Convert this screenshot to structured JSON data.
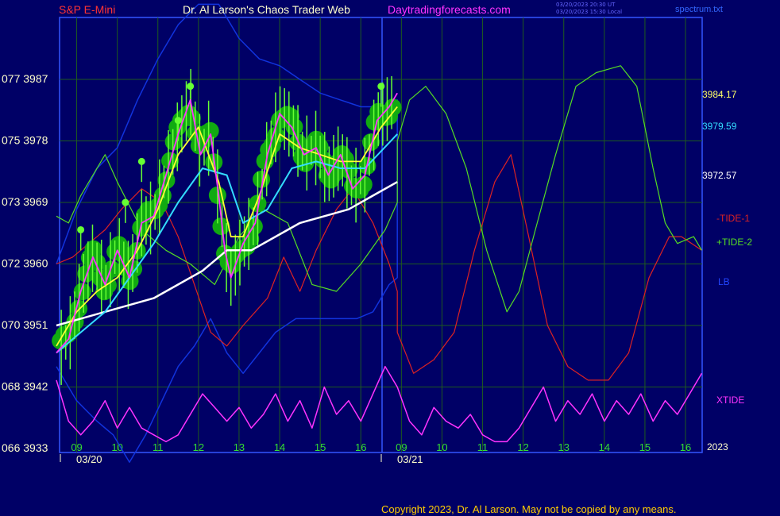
{
  "header": {
    "symbol": "S&P E-Mini",
    "title": "Dr. Al Larson's Chaos Trader Web",
    "site": "Daytradingforecasts.com",
    "ts_utc": "03/20/2023 20:30 UT",
    "ts_local": "03/20/2023 15:30 Local",
    "file": "spectrum.txt"
  },
  "right_labels": {
    "price_a": "3984.17",
    "price_b": "3979.59",
    "price_c": "3972.57",
    "tide1": "-TIDE-1",
    "tide2": "+TIDE-2",
    "lb": "LB",
    "xtide": "XTIDE",
    "year": "2023"
  },
  "copyright": "Copyright 2023, Dr. Al Larson. May not be copied by any means.",
  "colors": {
    "background": "#000066",
    "grid": "#1e5a1e",
    "axis": "#3355ff",
    "price": "#ff33ff",
    "ma_yellow": "#ffff33",
    "ma_cyan": "#33ddff",
    "ma_white": "#ffffff",
    "tide1": "#dd2222",
    "tide2": "#55dd22",
    "lb": "#1133dd",
    "xtide": "#ff33ff",
    "dots": "#11aa11",
    "bars": "#66ff33"
  },
  "chart_data": {
    "type": "line",
    "y_ticks": [
      {
        "label": "066 3933",
        "value": 3933
      },
      {
        "label": "068 3942",
        "value": 3942
      },
      {
        "label": "070 3951",
        "value": 3951
      },
      {
        "label": "072 3960",
        "value": 3960
      },
      {
        "label": "073 3969",
        "value": 3969
      },
      {
        "label": "075 3978",
        "value": 3978
      },
      {
        "label": "077 3987",
        "value": 3987
      }
    ],
    "ylim": [
      3933,
      3992
    ],
    "x_ticks": [
      {
        "label": "09",
        "t": 0.5
      },
      {
        "label": "10",
        "t": 1.5
      },
      {
        "label": "11",
        "t": 2.5
      },
      {
        "label": "12",
        "t": 3.5
      },
      {
        "label": "13",
        "t": 4.5
      },
      {
        "label": "14",
        "t": 5.5
      },
      {
        "label": "15",
        "t": 6.5
      },
      {
        "label": "16",
        "t": 7.5
      },
      {
        "label": "09",
        "t": 8.5
      },
      {
        "label": "10",
        "t": 9.5
      },
      {
        "label": "11",
        "t": 10.5
      },
      {
        "label": "12",
        "t": 11.5
      },
      {
        "label": "13",
        "t": 12.5
      },
      {
        "label": "14",
        "t": 13.5
      },
      {
        "label": "15",
        "t": 14.5
      },
      {
        "label": "16",
        "t": 15.5
      }
    ],
    "dates": [
      {
        "label": "03/20",
        "t": 0.5
      },
      {
        "label": "03/21",
        "t": 8.5
      }
    ],
    "xlim": [
      0,
      15.9
    ],
    "series": [
      {
        "key": "price",
        "points": [
          [
            0,
            3947
          ],
          [
            0.3,
            3949
          ],
          [
            0.6,
            3956
          ],
          [
            0.9,
            3961
          ],
          [
            1.2,
            3957
          ],
          [
            1.5,
            3962
          ],
          [
            1.8,
            3958
          ],
          [
            2.1,
            3966
          ],
          [
            2.4,
            3967
          ],
          [
            2.7,
            3973
          ],
          [
            3.0,
            3979
          ],
          [
            3.3,
            3984
          ],
          [
            3.55,
            3976
          ],
          [
            3.8,
            3979
          ],
          [
            4.0,
            3970
          ],
          [
            4.15,
            3962
          ],
          [
            4.3,
            3958
          ],
          [
            4.6,
            3963
          ],
          [
            4.9,
            3966
          ],
          [
            5.2,
            3976
          ],
          [
            5.5,
            3982
          ],
          [
            5.8,
            3980
          ],
          [
            6.1,
            3976
          ],
          [
            6.4,
            3977
          ],
          [
            6.7,
            3973
          ],
          [
            7.0,
            3976
          ],
          [
            7.3,
            3971
          ],
          [
            7.6,
            3973
          ],
          [
            7.9,
            3981
          ],
          [
            8.2,
            3983
          ],
          [
            8.4,
            3985
          ]
        ]
      },
      {
        "key": "ma_yellow",
        "points": [
          [
            0,
            3948
          ],
          [
            0.5,
            3953
          ],
          [
            1.0,
            3956
          ],
          [
            1.5,
            3958
          ],
          [
            2.0,
            3962
          ],
          [
            2.5,
            3968
          ],
          [
            3.0,
            3976
          ],
          [
            3.5,
            3980
          ],
          [
            4.0,
            3972
          ],
          [
            4.3,
            3964
          ],
          [
            4.6,
            3964
          ],
          [
            5.0,
            3970
          ],
          [
            5.5,
            3979
          ],
          [
            6.0,
            3977
          ],
          [
            6.5,
            3976
          ],
          [
            7.0,
            3975
          ],
          [
            7.5,
            3975
          ],
          [
            8.0,
            3980
          ],
          [
            8.4,
            3983
          ]
        ]
      },
      {
        "key": "ma_cyan",
        "points": [
          [
            0,
            3947
          ],
          [
            0.6,
            3950
          ],
          [
            1.2,
            3953
          ],
          [
            1.8,
            3958
          ],
          [
            2.4,
            3963
          ],
          [
            3.0,
            3969
          ],
          [
            3.6,
            3974
          ],
          [
            4.2,
            3973
          ],
          [
            4.6,
            3966
          ],
          [
            5.2,
            3968
          ],
          [
            5.8,
            3974
          ],
          [
            6.4,
            3975
          ],
          [
            7.0,
            3974
          ],
          [
            7.6,
            3974
          ],
          [
            8.4,
            3979
          ]
        ]
      },
      {
        "key": "ma_white",
        "points": [
          [
            0,
            3951
          ],
          [
            0.6,
            3952
          ],
          [
            1.2,
            3953
          ],
          [
            1.8,
            3954
          ],
          [
            2.4,
            3955
          ],
          [
            3.0,
            3957
          ],
          [
            3.6,
            3959
          ],
          [
            4.2,
            3962
          ],
          [
            4.8,
            3962
          ],
          [
            5.4,
            3964
          ],
          [
            6.0,
            3966
          ],
          [
            6.6,
            3967
          ],
          [
            7.2,
            3968
          ],
          [
            7.8,
            3970
          ],
          [
            8.4,
            3972
          ]
        ]
      },
      {
        "key": "tide2",
        "points": [
          [
            0,
            3967
          ],
          [
            0.3,
            3966
          ],
          [
            0.6,
            3970
          ],
          [
            0.9,
            3973
          ],
          [
            1.2,
            3976
          ],
          [
            1.5,
            3972
          ],
          [
            2.1,
            3965
          ],
          [
            2.7,
            3962
          ],
          [
            3.3,
            3960
          ],
          [
            3.9,
            3957
          ],
          [
            4.5,
            3964
          ],
          [
            5.1,
            3968
          ],
          [
            5.7,
            3966
          ],
          [
            6.3,
            3957
          ],
          [
            6.9,
            3956
          ],
          [
            7.5,
            3960
          ],
          [
            8.1,
            3965
          ],
          [
            8.4,
            3969
          ],
          [
            8.4,
            3978
          ],
          [
            8.7,
            3984
          ],
          [
            9.1,
            3986
          ],
          [
            9.6,
            3982
          ],
          [
            10.1,
            3974
          ],
          [
            10.6,
            3962
          ],
          [
            11.1,
            3953
          ],
          [
            11.4,
            3956
          ],
          [
            11.8,
            3965
          ],
          [
            12.3,
            3976
          ],
          [
            12.8,
            3986
          ],
          [
            13.3,
            3988
          ],
          [
            13.9,
            3989
          ],
          [
            14.3,
            3986
          ],
          [
            14.7,
            3974
          ],
          [
            15.0,
            3966
          ],
          [
            15.3,
            3963
          ],
          [
            15.7,
            3964
          ],
          [
            15.9,
            3962
          ]
        ]
      },
      {
        "key": "tide1",
        "points": [
          [
            0,
            3960
          ],
          [
            0.4,
            3961
          ],
          [
            0.8,
            3963
          ],
          [
            1.2,
            3965
          ],
          [
            1.6,
            3968
          ],
          [
            2.1,
            3971
          ],
          [
            2.6,
            3969
          ],
          [
            3.0,
            3964
          ],
          [
            3.4,
            3957
          ],
          [
            3.8,
            3950
          ],
          [
            4.2,
            3948
          ],
          [
            4.6,
            3951
          ],
          [
            5.2,
            3955
          ],
          [
            5.6,
            3961
          ],
          [
            6.0,
            3956
          ],
          [
            6.4,
            3962
          ],
          [
            6.9,
            3968
          ],
          [
            7.3,
            3971
          ],
          [
            7.8,
            3966
          ],
          [
            8.2,
            3960
          ],
          [
            8.4,
            3956
          ],
          [
            8.4,
            3950
          ],
          [
            8.8,
            3944
          ],
          [
            9.3,
            3946
          ],
          [
            9.8,
            3950
          ],
          [
            10.3,
            3962
          ],
          [
            10.8,
            3972
          ],
          [
            11.2,
            3976
          ],
          [
            11.6,
            3965
          ],
          [
            12.1,
            3951
          ],
          [
            12.6,
            3945
          ],
          [
            13.1,
            3943
          ],
          [
            13.6,
            3943
          ],
          [
            14.1,
            3947
          ],
          [
            14.6,
            3958
          ],
          [
            15.1,
            3964
          ],
          [
            15.4,
            3964
          ],
          [
            15.9,
            3962
          ]
        ]
      },
      {
        "key": "lb",
        "points": [
          [
            0,
            3960
          ],
          [
            0.5,
            3968
          ],
          [
            1.0,
            3974
          ],
          [
            1.5,
            3977
          ],
          [
            2.0,
            3984
          ],
          [
            2.5,
            3990
          ],
          [
            3.0,
            3995
          ],
          [
            3.5,
            3998
          ],
          [
            4.0,
            3998
          ],
          [
            4.5,
            3993
          ],
          [
            5.0,
            3990
          ],
          [
            5.5,
            3989
          ],
          [
            6.0,
            3987
          ],
          [
            6.5,
            3985
          ],
          [
            7.0,
            3984
          ],
          [
            7.5,
            3983
          ],
          [
            8.0,
            3983
          ],
          [
            8.4,
            3984
          ],
          [
            8.4,
            3958
          ],
          [
            8.2,
            3957
          ],
          [
            7.8,
            3953
          ],
          [
            7.4,
            3952
          ],
          [
            6.9,
            3952
          ],
          [
            6.4,
            3952
          ],
          [
            5.9,
            3952
          ],
          [
            5.4,
            3950
          ],
          [
            5.0,
            3947
          ],
          [
            4.6,
            3944
          ],
          [
            4.2,
            3947
          ],
          [
            3.8,
            3952
          ],
          [
            3.4,
            3948
          ],
          [
            3.0,
            3945
          ],
          [
            2.6,
            3940
          ],
          [
            2.2,
            3935
          ],
          [
            1.8,
            3931
          ],
          [
            1.4,
            3935
          ],
          [
            1.0,
            3937
          ],
          [
            0.5,
            3940
          ],
          [
            0,
            3945
          ]
        ]
      },
      {
        "key": "xtide",
        "points": [
          [
            0,
            3943
          ],
          [
            0.3,
            3937
          ],
          [
            0.6,
            3935
          ],
          [
            0.9,
            3937
          ],
          [
            1.2,
            3940
          ],
          [
            1.5,
            3936
          ],
          [
            1.8,
            3939
          ],
          [
            2.1,
            3936
          ],
          [
            2.4,
            3935
          ],
          [
            2.7,
            3934
          ],
          [
            3.0,
            3935
          ],
          [
            3.3,
            3938
          ],
          [
            3.6,
            3941
          ],
          [
            3.9,
            3939
          ],
          [
            4.2,
            3937
          ],
          [
            4.5,
            3939
          ],
          [
            4.8,
            3936
          ],
          [
            5.1,
            3938
          ],
          [
            5.4,
            3941
          ],
          [
            5.7,
            3937
          ],
          [
            6.0,
            3940
          ],
          [
            6.3,
            3936
          ],
          [
            6.6,
            3942
          ],
          [
            6.9,
            3938
          ],
          [
            7.2,
            3940
          ],
          [
            7.5,
            3937
          ],
          [
            7.8,
            3941
          ],
          [
            8.1,
            3945
          ],
          [
            8.4,
            3942
          ],
          [
            8.7,
            3937
          ],
          [
            9.0,
            3935
          ],
          [
            9.3,
            3939
          ],
          [
            9.6,
            3937
          ],
          [
            9.9,
            3936
          ],
          [
            10.2,
            3938
          ],
          [
            10.5,
            3935
          ],
          [
            10.8,
            3934
          ],
          [
            11.1,
            3934
          ],
          [
            11.4,
            3936
          ],
          [
            11.7,
            3939
          ],
          [
            12.0,
            3942
          ],
          [
            12.3,
            3937
          ],
          [
            12.6,
            3940
          ],
          [
            12.9,
            3938
          ],
          [
            13.2,
            3941
          ],
          [
            13.5,
            3937
          ],
          [
            13.8,
            3940
          ],
          [
            14.1,
            3938
          ],
          [
            14.4,
            3941
          ],
          [
            14.7,
            3937
          ],
          [
            15.0,
            3940
          ],
          [
            15.3,
            3938
          ],
          [
            15.6,
            3941
          ],
          [
            15.9,
            3944
          ]
        ]
      }
    ]
  }
}
